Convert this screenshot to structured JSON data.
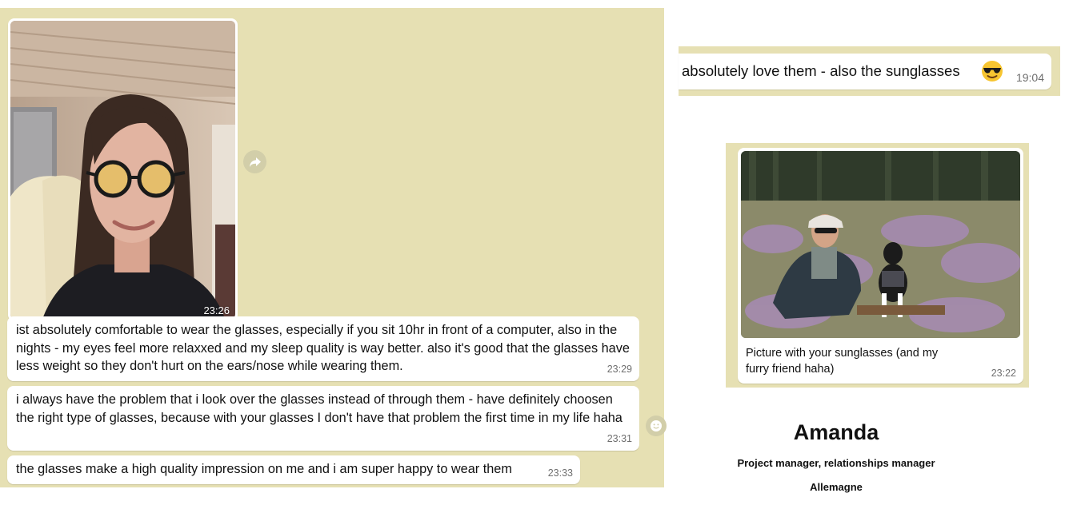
{
  "chat": {
    "photo_message": {
      "time": "23:26",
      "image": "selfie-with-tinted-round-glasses"
    },
    "messages": [
      {
        "text": "ist absolutely comfortable to wear the glasses, especially if you sit 10hr in front of a computer, also in the nights - my eyes feel more relaxxed and my sleep quality is way better. also it's good that the glasses have less weight so they don't hurt on the ears/nose while wearing them.",
        "time": "23:29"
      },
      {
        "text": "i always have the problem that i look over the glasses instead of through them - have definitely choosen the right type of glasses, because with your glasses I don't have that problem the first time in my life haha",
        "time": "23:31"
      },
      {
        "text": "the glasses make a high quality impression on me and i am super happy to wear them",
        "time": "23:33"
      }
    ],
    "icons": {
      "forward": "forward-arrow-icon",
      "reaction": "smiley-icon"
    }
  },
  "top_message": {
    "text": "absolutely love them - also the sunglasses",
    "emoji": "sunglasses-emoji",
    "time": "19:04"
  },
  "picture_message": {
    "caption": "Picture with your sunglasses (and my furry friend haha)",
    "time": "23:22",
    "image": "woman-with-dog-in-heather-field"
  },
  "profile": {
    "name": "Amanda",
    "role": "Project manager, relationships manager",
    "location": "Allemagne"
  },
  "colors": {
    "chat_background": "#e6e0b3",
    "bubble": "#ffffff",
    "timestamp": "#6f6f6f"
  }
}
